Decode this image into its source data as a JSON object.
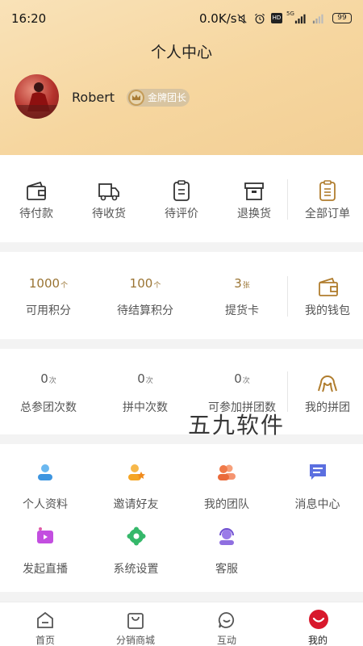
{
  "status": {
    "time": "16:20",
    "speed": "0.0K/s",
    "battery": "99",
    "hd": "HD",
    "net": "5G"
  },
  "header": {
    "title": "个人中心",
    "username": "Robert",
    "badge": "金牌团长"
  },
  "orders": {
    "items": [
      {
        "label": "待付款",
        "icon": "wallet-icon"
      },
      {
        "label": "待收货",
        "icon": "truck-icon"
      },
      {
        "label": "待评价",
        "icon": "clipboard-icon"
      },
      {
        "label": "退换货",
        "icon": "box-icon"
      }
    ],
    "all": {
      "label": "全部订单",
      "icon": "orders-icon"
    }
  },
  "assets": {
    "items": [
      {
        "value": "1000",
        "unit": "个",
        "label": "可用积分"
      },
      {
        "value": "100",
        "unit": "个",
        "label": "待结算积分"
      },
      {
        "value": "3",
        "unit": "张",
        "label": "提货卡"
      }
    ],
    "wallet": {
      "label": "我的钱包",
      "icon": "wallet-icon"
    }
  },
  "groups": {
    "items": [
      {
        "value": "0",
        "unit": "次",
        "label": "总参团次数"
      },
      {
        "value": "0",
        "unit": "次",
        "label": "拼中次数"
      },
      {
        "value": "0",
        "unit": "次",
        "label": "可参加拼团数"
      }
    ],
    "mine": {
      "label": "我的拼团",
      "icon": "group-icon"
    }
  },
  "watermark": "五九软件",
  "services": [
    {
      "label": "个人资料",
      "icon": "profile-icon",
      "color": "#4aa3e8"
    },
    {
      "label": "邀请好友",
      "icon": "invite-icon",
      "color": "#f5a524"
    },
    {
      "label": "我的团队",
      "icon": "team-icon",
      "color": "#f07a4a"
    },
    {
      "label": "消息中心",
      "icon": "message-icon",
      "color": "#5b6fe0"
    },
    {
      "label": "发起直播",
      "icon": "live-icon",
      "color": "#b14ad8"
    },
    {
      "label": "系统设置",
      "icon": "settings-icon",
      "color": "#35b86a"
    },
    {
      "label": "客服",
      "icon": "support-icon",
      "color": "#8f6fe0"
    }
  ],
  "tabs": [
    {
      "label": "首页",
      "icon": "home-icon"
    },
    {
      "label": "分销商城",
      "icon": "shop-bag-icon"
    },
    {
      "label": "互动",
      "icon": "chat-icon"
    },
    {
      "label": "我的",
      "icon": "profile-face-icon",
      "active": true
    }
  ],
  "colors": {
    "accent": "#9a7433",
    "header_bg": "#f6d69f",
    "active_tab": "#d8182c"
  }
}
